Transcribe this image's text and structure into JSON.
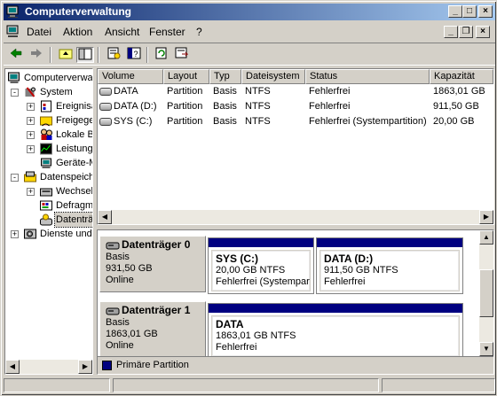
{
  "window": {
    "title": "Computerverwaltung",
    "controls": [
      "_",
      "□",
      "×"
    ]
  },
  "menu": {
    "items": [
      {
        "label": "Datei",
        "underline": "D"
      },
      {
        "label": "Aktion",
        "underline": "A"
      },
      {
        "label": "Ansicht",
        "underline": "n"
      },
      {
        "label": "Fenster",
        "underline": "F"
      },
      {
        "label": "?",
        "underline": "?"
      }
    ],
    "mdi_controls": [
      "_",
      "❐",
      "×"
    ]
  },
  "toolbar": {
    "buttons": [
      "back-icon",
      "forward-icon",
      "up-folder-icon",
      "show-hide-tree-icon",
      "properties-icon",
      "help-icon",
      "refresh-icon",
      "export-icon"
    ]
  },
  "tree": {
    "items": [
      {
        "label": "Computerverwaltung (Lokal)",
        "icon": "computer-icon",
        "level": 0,
        "expander": ""
      },
      {
        "label": "System",
        "icon": "tools-icon",
        "level": 1,
        "expander": "-"
      },
      {
        "label": "Ereignisanzeige",
        "icon": "event-viewer-icon",
        "level": 2,
        "expander": "+"
      },
      {
        "label": "Freigegebene Ordner",
        "icon": "shared-folder-icon",
        "level": 2,
        "expander": "+"
      },
      {
        "label": "Lokale Benutzer und Gruppen",
        "icon": "users-icon",
        "level": 2,
        "expander": "+"
      },
      {
        "label": "Leistungsprotokolle und Warnungen",
        "icon": "performance-icon",
        "level": 2,
        "expander": "+"
      },
      {
        "label": "Geräte-Manager",
        "icon": "device-manager-icon",
        "level": 2,
        "expander": ""
      },
      {
        "label": "Datenspeicher",
        "icon": "storage-icon",
        "level": 1,
        "expander": "-"
      },
      {
        "label": "Wechselmedien",
        "icon": "removable-media-icon",
        "level": 2,
        "expander": "+"
      },
      {
        "label": "Defragmentierung",
        "icon": "defrag-icon",
        "level": 2,
        "expander": ""
      },
      {
        "label": "Datenträgerverwaltung",
        "icon": "disk-management-icon",
        "level": 2,
        "expander": "",
        "selected": true
      },
      {
        "label": "Dienste und Anwendungen",
        "icon": "services-icon",
        "level": 1,
        "expander": "+"
      }
    ]
  },
  "volumes": {
    "columns": [
      "Volume",
      "Layout",
      "Typ",
      "Dateisystem",
      "Status",
      "Kapazität"
    ],
    "rows": [
      [
        "DATA",
        "Partition",
        "Basis",
        "NTFS",
        "Fehlerfrei",
        "1863,01 GB"
      ],
      [
        "DATA (D:)",
        "Partition",
        "Basis",
        "NTFS",
        "Fehlerfrei",
        "911,50 GB"
      ],
      [
        "SYS (C:)",
        "Partition",
        "Basis",
        "NTFS",
        "Fehlerfrei (Systempartition)",
        "20,00 GB"
      ]
    ]
  },
  "disks": [
    {
      "name": "Datenträger 0",
      "type": "Basis",
      "size": "931,50 GB",
      "state": "Online",
      "partitions": [
        {
          "name": "SYS  (C:)",
          "size": "20,00 GB NTFS",
          "status": "Fehlerfrei (Systempartition)"
        },
        {
          "name": "DATA  (D:)",
          "size": "911,50 GB NTFS",
          "status": "Fehlerfrei"
        }
      ]
    },
    {
      "name": "Datenträger 1",
      "type": "Basis",
      "size": "1863,01 GB",
      "state": "Online",
      "partitions": [
        {
          "name": "DATA",
          "size": "1863,01 GB NTFS",
          "status": "Fehlerfrei"
        }
      ]
    }
  ],
  "legend": {
    "label": "Primäre Partition",
    "color": "#000080"
  }
}
